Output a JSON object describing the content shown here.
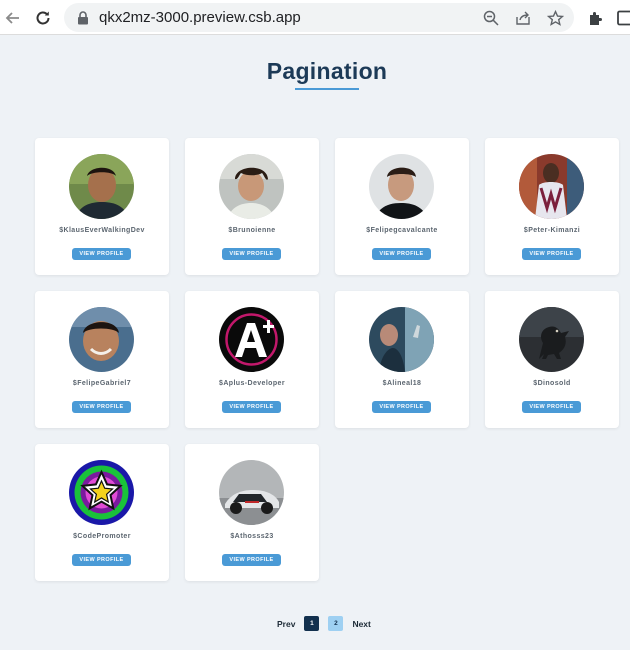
{
  "browser": {
    "url": "qkx2mz-3000.preview.csb.app"
  },
  "page": {
    "title": "Pagination"
  },
  "cards": [
    {
      "username": "$KlausEverWalkingDev",
      "button": "VIEW PROFILE"
    },
    {
      "username": "$Brunoienne",
      "button": "VIEW PROFILE"
    },
    {
      "username": "$Felipegcavalcante",
      "button": "VIEW PROFILE"
    },
    {
      "username": "$Peter-Kimanzi",
      "button": "VIEW PROFILE"
    },
    {
      "username": "$FelipeGabriel7",
      "button": "VIEW PROFILE"
    },
    {
      "username": "$Aplus-Developer",
      "button": "VIEW PROFILE"
    },
    {
      "username": "$Alineal18",
      "button": "VIEW PROFILE"
    },
    {
      "username": "$Dinosold",
      "button": "VIEW PROFILE"
    },
    {
      "username": "$CodePromoter",
      "button": "VIEW PROFILE"
    },
    {
      "username": "$Athosss23",
      "button": "VIEW PROFILE"
    }
  ],
  "pagination": {
    "prev": "Prev",
    "pages": [
      "1",
      "2"
    ],
    "current": "1",
    "next": "Next"
  },
  "colors": {
    "accent": "#4a9ad6",
    "title": "#1c3a57",
    "background": "#eef2f6",
    "active_page": "#12304e",
    "inactive_page": "#9ed0f2"
  }
}
